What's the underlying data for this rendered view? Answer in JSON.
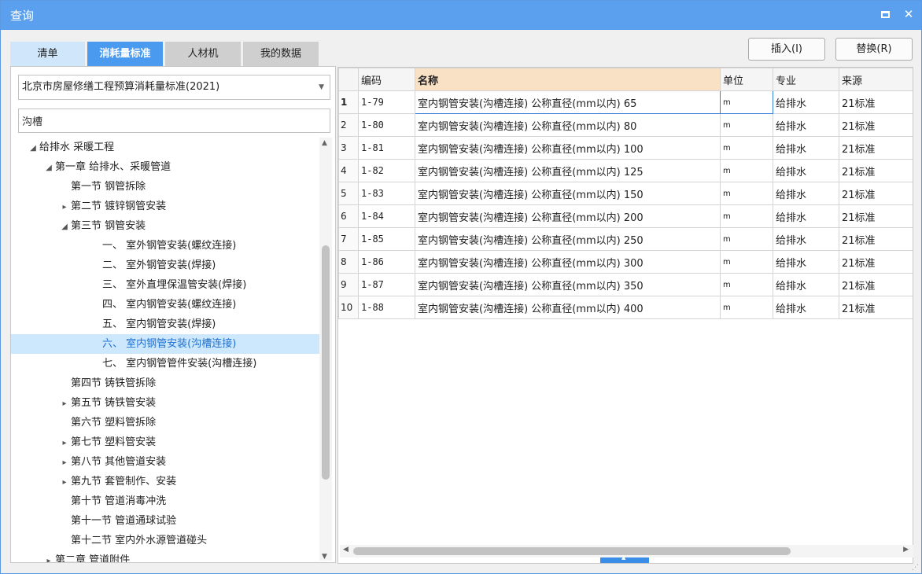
{
  "window": {
    "title": "查询"
  },
  "tabs": [
    {
      "label": "清单"
    },
    {
      "label": "消耗量标准"
    },
    {
      "label": "人材机"
    },
    {
      "label": "我的数据"
    }
  ],
  "toolbar": {
    "insert_label": "插入(I)",
    "replace_label": "替换(R)"
  },
  "left": {
    "library_value": "北京市房屋修缮工程预算消耗量标准(2021)",
    "search_value": "沟槽",
    "tree": [
      {
        "label": "给排水 采暖工程",
        "level": 0,
        "toggle": "expanded"
      },
      {
        "label": "第一章 给排水、采暖管道",
        "level": 1,
        "toggle": "expanded"
      },
      {
        "label": "第一节 钢管拆除",
        "level": 2,
        "toggle": "none"
      },
      {
        "label": "第二节 镀锌钢管安装",
        "level": 2,
        "toggle": "collapsed"
      },
      {
        "label": "第三节 钢管安装",
        "level": 2,
        "toggle": "expanded"
      },
      {
        "label": "一、 室外钢管安装(螺纹连接)",
        "level": 3,
        "toggle": "none"
      },
      {
        "label": "二、 室外钢管安装(焊接)",
        "level": 3,
        "toggle": "none"
      },
      {
        "label": "三、 室外直埋保温管安装(焊接)",
        "level": 3,
        "toggle": "none"
      },
      {
        "label": "四、 室内钢管安装(螺纹连接)",
        "level": 3,
        "toggle": "none"
      },
      {
        "label": "五、 室内钢管安装(焊接)",
        "level": 3,
        "toggle": "none"
      },
      {
        "label": "六、 室内钢管安装(沟槽连接)",
        "level": 3,
        "toggle": "none",
        "selected": true
      },
      {
        "label": "七、 室内钢管管件安装(沟槽连接)",
        "level": 3,
        "toggle": "none"
      },
      {
        "label": "第四节 铸铁管拆除",
        "level": 2,
        "toggle": "none"
      },
      {
        "label": "第五节 铸铁管安装",
        "level": 2,
        "toggle": "collapsed"
      },
      {
        "label": "第六节 塑料管拆除",
        "level": 2,
        "toggle": "none"
      },
      {
        "label": "第七节 塑料管安装",
        "level": 2,
        "toggle": "collapsed"
      },
      {
        "label": "第八节 其他管道安装",
        "level": 2,
        "toggle": "collapsed"
      },
      {
        "label": "第九节 套管制作、安装",
        "level": 2,
        "toggle": "collapsed"
      },
      {
        "label": "第十节 管道消毒冲洗",
        "level": 2,
        "toggle": "none"
      },
      {
        "label": "第十一节 管道通球试验",
        "level": 2,
        "toggle": "none"
      },
      {
        "label": "第十二节 室内外水源管道碰头",
        "level": 2,
        "toggle": "none"
      },
      {
        "label": "第二章 管道附件",
        "level": 1,
        "toggle": "collapsed"
      }
    ]
  },
  "grid": {
    "columns": [
      "",
      "编码",
      "名称",
      "单位",
      "专业",
      "来源"
    ],
    "rows": [
      {
        "n": "1",
        "code": "1-79",
        "name": "室内钢管安装(沟槽连接) 公称直径(mm以内) 65",
        "unit": "m",
        "major": "给排水",
        "source": "21标准"
      },
      {
        "n": "2",
        "code": "1-80",
        "name": "室内钢管安装(沟槽连接) 公称直径(mm以内) 80",
        "unit": "m",
        "major": "给排水",
        "source": "21标准"
      },
      {
        "n": "3",
        "code": "1-81",
        "name": "室内钢管安装(沟槽连接) 公称直径(mm以内) 100",
        "unit": "m",
        "major": "给排水",
        "source": "21标准"
      },
      {
        "n": "4",
        "code": "1-82",
        "name": "室内钢管安装(沟槽连接) 公称直径(mm以内) 125",
        "unit": "m",
        "major": "给排水",
        "source": "21标准"
      },
      {
        "n": "5",
        "code": "1-83",
        "name": "室内钢管安装(沟槽连接) 公称直径(mm以内) 150",
        "unit": "m",
        "major": "给排水",
        "source": "21标准"
      },
      {
        "n": "6",
        "code": "1-84",
        "name": "室内钢管安装(沟槽连接) 公称直径(mm以内) 200",
        "unit": "m",
        "major": "给排水",
        "source": "21标准"
      },
      {
        "n": "7",
        "code": "1-85",
        "name": "室内钢管安装(沟槽连接) 公称直径(mm以内) 250",
        "unit": "m",
        "major": "给排水",
        "source": "21标准"
      },
      {
        "n": "8",
        "code": "1-86",
        "name": "室内钢管安装(沟槽连接) 公称直径(mm以内) 300",
        "unit": "m",
        "major": "给排水",
        "source": "21标准"
      },
      {
        "n": "9",
        "code": "1-87",
        "name": "室内钢管安装(沟槽连接) 公称直径(mm以内) 350",
        "unit": "m",
        "major": "给排水",
        "source": "21标准"
      },
      {
        "n": "10",
        "code": "1-88",
        "name": "室内钢管安装(沟槽连接) 公称直径(mm以内) 400",
        "unit": "m",
        "major": "给排水",
        "source": "21标准"
      }
    ]
  },
  "icons": {
    "maximize": "maximize-icon",
    "close": "close-icon",
    "dropdown": "chevron-down-icon",
    "expanded": "triangle-expanded-icon",
    "collapsed": "triangle-collapsed-icon"
  }
}
